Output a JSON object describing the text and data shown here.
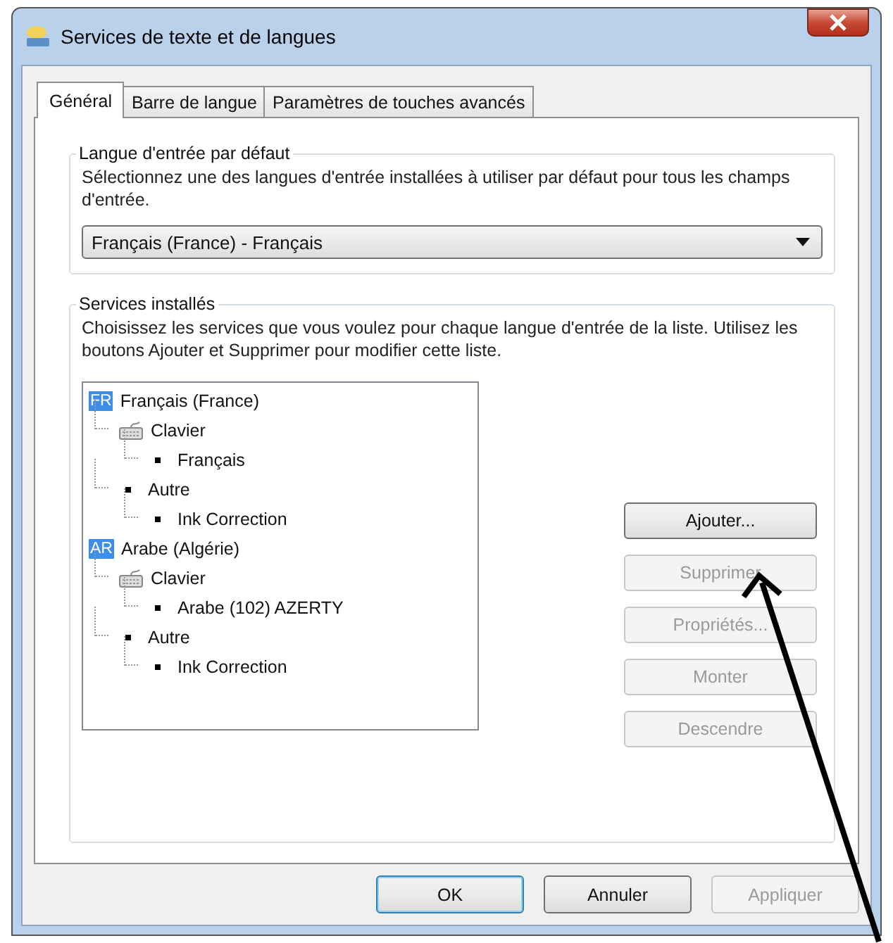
{
  "window": {
    "title": "Services de texte et de langues"
  },
  "tabs": [
    {
      "label": "Général",
      "selected": true
    },
    {
      "label": "Barre de langue",
      "selected": false
    },
    {
      "label": "Paramètres de touches avancés",
      "selected": false
    }
  ],
  "default_language": {
    "title": "Langue d'entrée par défaut",
    "description": "Sélectionnez une des langues d'entrée installées à utiliser par défaut pour tous les champs d'entrée.",
    "dropdown": {
      "value": "Français (France) - Français"
    }
  },
  "installed_services": {
    "title": "Services installés",
    "description": "Choisissez les services que vous voulez pour chaque langue d'entrée de la liste. Utilisez les boutons Ajouter et Supprimer pour modifier cette liste.",
    "tree": [
      {
        "kind": "language",
        "badge": "FR",
        "label": "Français (France)",
        "children": [
          {
            "kind": "keyboard",
            "label": "Clavier",
            "children": [
              {
                "kind": "bullet",
                "label": "Français"
              }
            ]
          },
          {
            "kind": "bullet",
            "label": "Autre",
            "children": [
              {
                "kind": "bullet",
                "label": "Ink Correction"
              }
            ]
          }
        ]
      },
      {
        "kind": "language",
        "badge": "AR",
        "label": "Arabe (Algérie)",
        "children": [
          {
            "kind": "keyboard",
            "label": "Clavier",
            "children": [
              {
                "kind": "bullet",
                "label": "Arabe (102) AZERTY"
              }
            ]
          },
          {
            "kind": "bullet",
            "label": "Autre",
            "children": [
              {
                "kind": "bullet",
                "label": "Ink Correction"
              }
            ]
          }
        ]
      }
    ],
    "buttons": [
      {
        "label": "Ajouter...",
        "disabled": false
      },
      {
        "label": "Supprimer",
        "disabled": true
      },
      {
        "label": "Propriétés...",
        "disabled": true
      },
      {
        "label": "Monter",
        "disabled": true
      },
      {
        "label": "Descendre",
        "disabled": true
      }
    ]
  },
  "footer_buttons": [
    {
      "label": "OK",
      "disabled": false,
      "default": true
    },
    {
      "label": "Annuler",
      "disabled": false,
      "default": false
    },
    {
      "label": "Appliquer",
      "disabled": true,
      "default": false
    }
  ]
}
